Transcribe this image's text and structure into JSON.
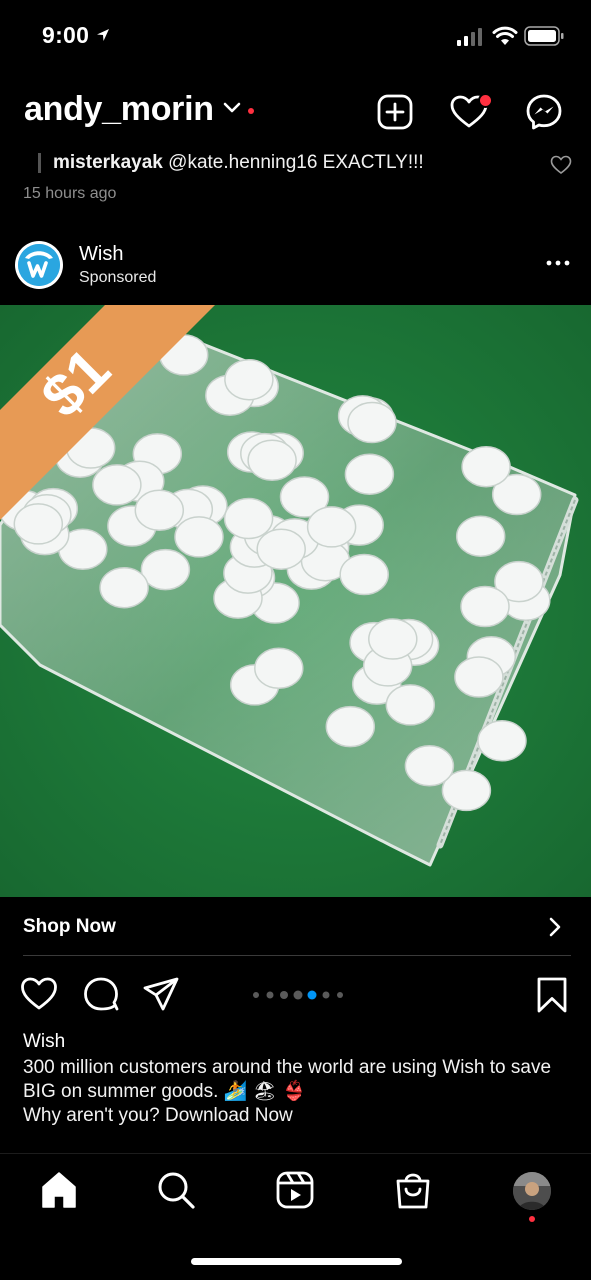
{
  "status_bar": {
    "time": "9:00"
  },
  "header": {
    "account_name": "andy_morin"
  },
  "comment": {
    "username": "misterkayak",
    "text": "@kate.henning16 EXACTLY!!!",
    "time": "15 hours ago"
  },
  "post": {
    "username": "Wish",
    "label": "Sponsored",
    "image_badge": "$1",
    "cta": "Shop Now",
    "carousel": {
      "count": 7,
      "active_index": 4
    },
    "caption_user": "Wish",
    "caption_line1": "300 million customers around the world are using Wish to save BIG on summer goods. 🏄 🏖 👙",
    "caption_line2": "Why aren't you? Download Now"
  },
  "colors": {
    "background": "#000000",
    "notification_red": "#ff3040",
    "wish_blue": "#2aa6e0",
    "carousel_active": "#0095f6",
    "badge_orange": "#f0a050",
    "felt_green": "#1f7a3a"
  },
  "icons": {
    "header": [
      "new-post-icon",
      "heart-icon",
      "messenger-icon"
    ],
    "actions": [
      "heart-icon",
      "comment-icon",
      "share-icon",
      "bookmark-icon"
    ],
    "tabs": [
      "home-icon",
      "search-icon",
      "reels-icon",
      "shop-icon",
      "profile-avatar"
    ]
  }
}
